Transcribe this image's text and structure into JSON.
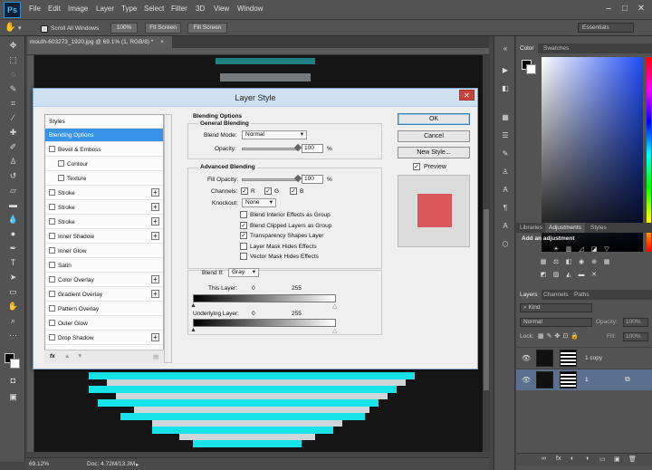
{
  "app": {
    "logo": "Ps",
    "menu": [
      "File",
      "Edit",
      "Image",
      "Layer",
      "Type",
      "Select",
      "Filter",
      "3D",
      "View",
      "Window"
    ],
    "window_controls": [
      "–",
      "□",
      "✕"
    ]
  },
  "options_bar": {
    "scroll_all_windows": "Scroll All Windows",
    "zoom_btn": "100%",
    "fit_screen": "Fit Screen",
    "fill_screen": "Fill Screen",
    "workspace": "Essentials"
  },
  "document": {
    "tab_label": "mouth-603273_1920.jpg @ 69.1% (1, RGB/8) *",
    "tab_close": "×",
    "zoom": "69.12%",
    "doc_size": "Doc: 4.72M/13.3M"
  },
  "panels": {
    "color_tabs": [
      "Color",
      "Swatches"
    ],
    "adjust_tabs": [
      "Libraries",
      "Adjustments",
      "Styles"
    ],
    "add_adjustment": "Add an adjustment",
    "layers_tabs": [
      "Layers",
      "Channels",
      "Paths"
    ],
    "kind": "Kind",
    "blend_mode": "Normal",
    "opacity_label": "Opacity:",
    "opacity_value": "100%",
    "lock_label": "Lock:",
    "fill_label": "Fill:",
    "fill_value": "100%",
    "layers": [
      {
        "name": "1 copy"
      },
      {
        "name": "1"
      }
    ],
    "layer_footer_icons": [
      "∞",
      "fx",
      "◐",
      "◑",
      "▭",
      "▣",
      "🗑"
    ],
    "colors": {
      "accent_selected_layer": "#5b6f8f"
    }
  },
  "dialog": {
    "title": "Layer Style",
    "close": "✕",
    "styles_header": "Styles",
    "styles": [
      {
        "label": "Blending Options",
        "checkbox": false,
        "plus": false,
        "selected": true
      },
      {
        "label": "Bevel & Emboss",
        "checkbox": true,
        "plus": false
      },
      {
        "label": "Contour",
        "checkbox": true,
        "plus": false,
        "indent": true
      },
      {
        "label": "Texture",
        "checkbox": true,
        "plus": false,
        "indent": true
      },
      {
        "label": "Stroke",
        "checkbox": true,
        "plus": true
      },
      {
        "label": "Stroke",
        "checkbox": true,
        "plus": true
      },
      {
        "label": "Stroke",
        "checkbox": true,
        "plus": true
      },
      {
        "label": "Inner Shadow",
        "checkbox": true,
        "plus": true
      },
      {
        "label": "Inner Glow",
        "checkbox": true,
        "plus": false
      },
      {
        "label": "Satin",
        "checkbox": true,
        "plus": false
      },
      {
        "label": "Color Overlay",
        "checkbox": true,
        "plus": true
      },
      {
        "label": "Gradient Overlay",
        "checkbox": true,
        "plus": true
      },
      {
        "label": "Pattern Overlay",
        "checkbox": true,
        "plus": false
      },
      {
        "label": "Outer Glow",
        "checkbox": true,
        "plus": false
      },
      {
        "label": "Drop Shadow",
        "checkbox": true,
        "plus": true
      }
    ],
    "footer_fx": "fx",
    "footer_up": "▲",
    "footer_down": "▼",
    "footer_trash": "▤",
    "blending_options": "Blending Options",
    "general_blending": "General Blending",
    "blend_mode_label": "Blend Mode:",
    "blend_mode_value": "Normal",
    "opacity_label": "Opacity:",
    "opacity_value": "100",
    "opacity_pct": "%",
    "advanced_blending": "Advanced Blending",
    "fill_opacity_label": "Fill Opacity:",
    "fill_opacity_value": "100",
    "fill_opacity_pct": "%",
    "channels_label": "Channels:",
    "channel_r": "R",
    "channel_g": "G",
    "channel_b": "B",
    "knockout_label": "Knockout:",
    "knockout_value": "None",
    "options": [
      {
        "label": "Blend Interior Effects as Group",
        "checked": false
      },
      {
        "label": "Blend Clipped Layers as Group",
        "checked": true
      },
      {
        "label": "Transparency Shapes Layer",
        "checked": true
      },
      {
        "label": "Layer Mask Hides Effects",
        "checked": false
      },
      {
        "label": "Vector Mask Hides Effects",
        "checked": false
      }
    ],
    "blend_if_label": "Blend If:",
    "blend_if_value": "Gray",
    "this_layer_label": "This Layer:",
    "this_layer_min": "0",
    "this_layer_max": "255",
    "underlying_label": "Underlying Layer:",
    "underlying_min": "0",
    "underlying_max": "255",
    "ok": "OK",
    "cancel": "Cancel",
    "new_style": "New Style...",
    "preview": "Preview",
    "preview_color": "#d9575a",
    "check_mark": "✓"
  }
}
